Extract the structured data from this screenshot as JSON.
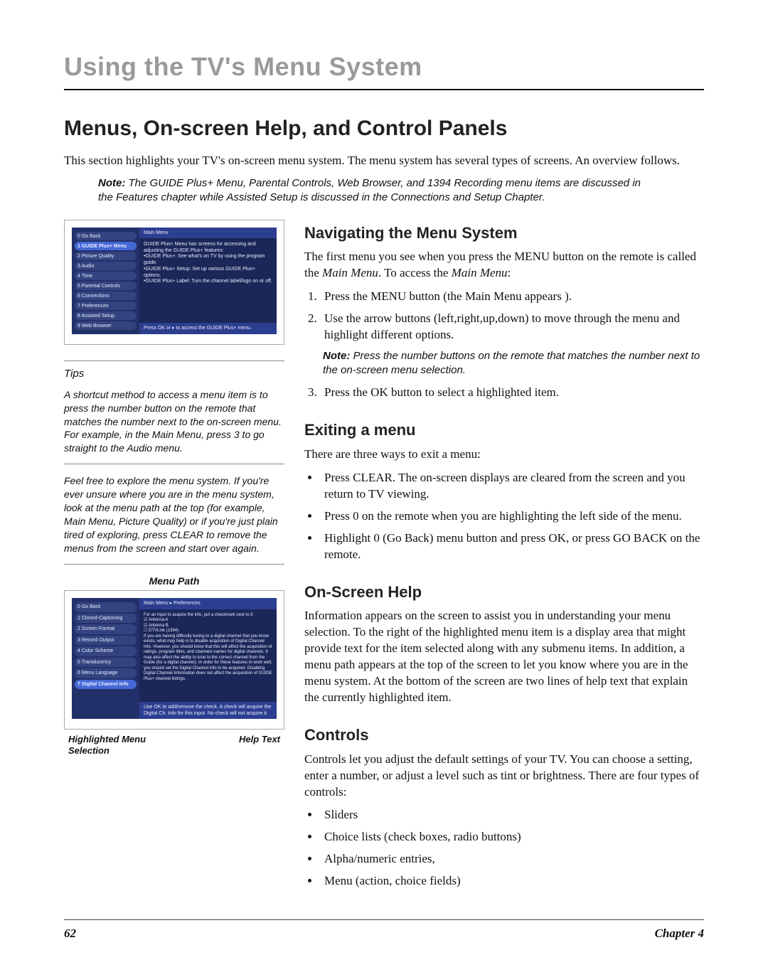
{
  "chapter_title": "Using the TV's Menu System",
  "page_title": "Menus, On-screen Help, and Control Panels",
  "intro": "This section highlights your TV's on-screen menu system. The menu system has several types of screens. An overview follows.",
  "top_note_label": "Note:",
  "top_note": "The GUIDE Plus+ Menu, Parental Controls, Web Browser, and 1394 Recording menu items are discussed in the Features chapter while Assisted Setup is discussed in the Connections and Setup Chapter.",
  "tips_heading": "Tips",
  "tip1": "A shortcut method to access a menu item is to press the number button on the remote that matches the number next to the on-screen menu. For example, in the Main Menu, press 3 to go straight to the Audio menu.",
  "tip2": "Feel free to explore the menu system. If you're ever unsure where you are in the menu system, look at the menu path at the top (for example, Main Menu, Picture Quality) or if you're just plain tired of exploring, press CLEAR to remove the menus from the screen and start over again.",
  "menu_path_label": "Menu Path",
  "callout_left": "Highlighted Menu Selection",
  "callout_right": "Help Text",
  "nav": {
    "heading": "Navigating the Menu System",
    "p1_a": "The first menu you see when you press the MENU button on the remote is called the ",
    "p1_ital1": "Main Menu",
    "p1_b": ". To access the ",
    "p1_ital2": "Main Menu",
    "p1_c": ":",
    "step1_a": "Press the MENU button (the ",
    "step1_ital": "Main Menu",
    "step1_b": " appears ",
    "step1_c": ").",
    "step2": "Use the arrow buttons (left,right,up,down) to move through the menu and highlight different options.",
    "note_label": "Note:",
    "note": "Press the number buttons on the remote that matches the number next to the on-screen menu selection.",
    "step3": "Press the OK button to select a highlighted item."
  },
  "exit": {
    "heading": "Exiting a menu",
    "intro": "There are three ways to exit a menu:",
    "b1": "Press CLEAR. The on-screen displays are cleared from the screen and you return to TV viewing.",
    "b2": "Press 0 on the remote when you are highlighting the left side of the menu.",
    "b3_a": "Highlight ",
    "b3_ital": "0 (Go Back)",
    "b3_b": " menu button and press OK, or press GO BACK on the remote."
  },
  "help": {
    "heading": "On-Screen Help",
    "p": "Information appears on the screen to assist you in understanding your menu selection.  To the right of the highlighted menu item is a display area that might provide text for the item selected along with any submenu items. In addition, a menu path appears at the top of the screen to let you know where you are in the menu system. At the bottom of the screen are two lines of help text that explain the currently highlighted item."
  },
  "controls": {
    "heading": "Controls",
    "p": "Controls let you adjust the default settings of your TV. You can choose a setting, enter a number, or adjust a level such as tint or brightness. There are four types of controls:",
    "b1": "Sliders",
    "b2": "Choice lists (check boxes, radio buttons)",
    "b3": "Alpha/numeric entries,",
    "b4": "Menu (action, choice fields)"
  },
  "tv1": {
    "crumb": "Main Menu",
    "items": [
      "0 Go Back",
      "1 GUIDE Plus+ Menu",
      "2 Picture Quality",
      "3 Audio",
      "4 Time",
      "5 Parental Controls",
      "6 Connections",
      "7 Preferences",
      "8 Assisted Setup",
      "9 Web Browser"
    ],
    "body": "GUIDE Plus+ Menu has screens for accessing and adjusting the GUIDE Plus+ features:\n•GUIDE Plus+: See what's on TV by using the program guide.\n•GUIDE Plus+ Setup: Set up various GUIDE Plus+ options.\n•GUIDE Plus+ Label: Turn the channel label/logo on or off.",
    "foot": "Press OK or ▸ to access the GUIDE Plus+ menu."
  },
  "tv2": {
    "crumb": "Main Menu ▸ Preferences",
    "items": [
      "0 Go Back",
      "1 Closed-Captioning",
      "2 Screen Format",
      "3 Record Output",
      "4 Color Scheme",
      "5 Translucency",
      "6 Menu Language",
      "7 Digital Channel Info"
    ],
    "body": "For an input to acquire the info, put a checkmark next to it:\n☑ Antenna A\n☑ Antenna B\n☐ DTVLink (1394)\nIf you are having difficulty tuning to a digital channel that you know exists, what may help is to disable acquisition of Digital Channel Info. However, you should know that this will affect the acquisition of ratings, program titles, and channels names for digital channels. It may also affect the ability to tune to the correct channel from the Guide (for a digital channel). In order for these features to work well, you should set the Digital Channel Info to be acquired. Disabling Digital Channel Information does not affect the acquisition of GUIDE Plus+ channel listings.",
    "foot": "Use OK to add/remove the check. A check will acquire the Digital Ch. Info for this input. No check will not acquire it."
  },
  "footer": {
    "page": "62",
    "chapter": "Chapter 4"
  }
}
